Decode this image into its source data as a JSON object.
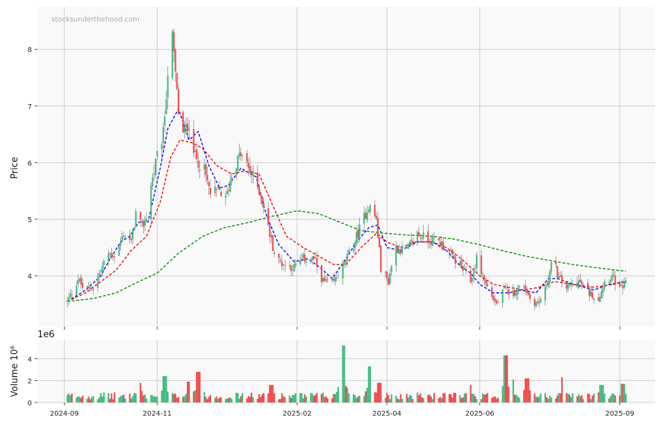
{
  "watermark": "stocksunderthehood.com",
  "chart_data": {
    "type": "candlestick",
    "start_date": "2024-09-03",
    "end_date": "2025-09-05",
    "x_ticks": [
      "2024-09",
      "2024-11",
      "2025-02",
      "2025-04",
      "2025-06",
      "2025-09"
    ],
    "x_tick_dates": [
      "2024-09-01",
      "2024-11-01",
      "2025-02-01",
      "2025-04-01",
      "2025-06-01",
      "2025-09-01"
    ],
    "price_panel": {
      "ylabel": "Price",
      "ylim": [
        3.1,
        8.75
      ],
      "yticks": [
        4,
        5,
        6,
        7,
        8
      ],
      "grid": true,
      "colors": {
        "up": "#3cba80",
        "down": "#f04848"
      },
      "anchor_points": [
        [
          "2024-09-03",
          3.55
        ],
        [
          "2024-09-06",
          3.7
        ],
        [
          "2024-09-10",
          3.95
        ],
        [
          "2024-09-14",
          3.75
        ],
        [
          "2024-09-20",
          3.8
        ],
        [
          "2024-09-25",
          4.1
        ],
        [
          "2024-09-30",
          4.4
        ],
        [
          "2024-10-05",
          4.35
        ],
        [
          "2024-10-10",
          4.75
        ],
        [
          "2024-10-15",
          4.6
        ],
        [
          "2024-10-18",
          5.1
        ],
        [
          "2024-10-22",
          4.85
        ],
        [
          "2024-10-25",
          5.05
        ],
        [
          "2024-10-28",
          5.6
        ],
        [
          "2024-11-01",
          6.1
        ],
        [
          "2024-11-05",
          6.5
        ],
        [
          "2024-11-08",
          7.6
        ],
        [
          "2024-11-11",
          8.2
        ],
        [
          "2024-11-15",
          6.9
        ],
        [
          "2024-11-18",
          6.5
        ],
        [
          "2024-11-22",
          6.7
        ],
        [
          "2024-11-26",
          6.1
        ],
        [
          "2024-12-02",
          5.85
        ],
        [
          "2024-12-06",
          5.45
        ],
        [
          "2024-12-12",
          5.5
        ],
        [
          "2024-12-16",
          5.35
        ],
        [
          "2024-12-21",
          5.9
        ],
        [
          "2024-12-26",
          6.15
        ],
        [
          "2025-01-03",
          5.75
        ],
        [
          "2025-01-08",
          5.45
        ],
        [
          "2025-01-13",
          4.85
        ],
        [
          "2025-01-18",
          4.3
        ],
        [
          "2025-01-24",
          4.2
        ],
        [
          "2025-01-30",
          4.15
        ],
        [
          "2025-02-05",
          4.3
        ],
        [
          "2025-02-12",
          4.3
        ],
        [
          "2025-02-18",
          3.9
        ],
        [
          "2025-02-24",
          3.85
        ],
        [
          "2025-03-03",
          4.15
        ],
        [
          "2025-03-10",
          4.55
        ],
        [
          "2025-03-15",
          4.9
        ],
        [
          "2025-03-20",
          5.25
        ],
        [
          "2025-03-25",
          5.0
        ],
        [
          "2025-03-28",
          4.15
        ],
        [
          "2025-04-02",
          3.9
        ],
        [
          "2025-04-06",
          4.5
        ],
        [
          "2025-04-14",
          4.45
        ],
        [
          "2025-04-21",
          4.75
        ],
        [
          "2025-04-28",
          4.65
        ],
        [
          "2025-05-06",
          4.6
        ],
        [
          "2025-05-12",
          4.4
        ],
        [
          "2025-05-20",
          4.15
        ],
        [
          "2025-05-26",
          3.9
        ],
        [
          "2025-05-30",
          4.3
        ],
        [
          "2025-06-05",
          3.85
        ],
        [
          "2025-06-12",
          3.5
        ],
        [
          "2025-06-17",
          3.75
        ],
        [
          "2025-06-23",
          3.7
        ],
        [
          "2025-06-30",
          3.85
        ],
        [
          "2025-07-04",
          3.6
        ],
        [
          "2025-07-09",
          3.5
        ],
        [
          "2025-07-14",
          3.75
        ],
        [
          "2025-07-19",
          4.3
        ],
        [
          "2025-07-23",
          3.95
        ],
        [
          "2025-07-28",
          3.8
        ],
        [
          "2025-08-05",
          3.9
        ],
        [
          "2025-08-12",
          3.7
        ],
        [
          "2025-08-18",
          3.6
        ],
        [
          "2025-08-22",
          3.9
        ],
        [
          "2025-08-27",
          4.0
        ],
        [
          "2025-09-01",
          3.75
        ],
        [
          "2025-09-05",
          3.85
        ]
      ],
      "moving_averages": [
        {
          "color": "#0000ee",
          "style": "dashed",
          "points": [
            [
              "2024-09-03",
              3.55
            ],
            [
              "2024-09-15",
              3.75
            ],
            [
              "2024-09-25",
              4.0
            ],
            [
              "2024-10-01",
              4.3
            ],
            [
              "2024-10-08",
              4.6
            ],
            [
              "2024-10-14",
              4.7
            ],
            [
              "2024-10-20",
              4.95
            ],
            [
              "2024-10-26",
              4.95
            ],
            [
              "2024-11-03",
              5.9
            ],
            [
              "2024-11-08",
              6.6
            ],
            [
              "2024-11-15",
              6.95
            ],
            [
              "2024-11-22",
              6.4
            ],
            [
              "2024-11-28",
              6.55
            ],
            [
              "2024-12-05",
              5.95
            ],
            [
              "2024-12-12",
              5.55
            ],
            [
              "2024-12-18",
              5.6
            ],
            [
              "2024-12-26",
              5.9
            ],
            [
              "2025-01-05",
              5.75
            ],
            [
              "2025-01-12",
              5.05
            ],
            [
              "2025-01-20",
              4.55
            ],
            [
              "2025-01-30",
              4.25
            ],
            [
              "2025-02-08",
              4.3
            ],
            [
              "2025-02-16",
              4.15
            ],
            [
              "2025-02-24",
              3.95
            ],
            [
              "2025-03-05",
              4.3
            ],
            [
              "2025-03-12",
              4.6
            ],
            [
              "2025-03-20",
              4.85
            ],
            [
              "2025-03-26",
              4.9
            ],
            [
              "2025-04-01",
              4.5
            ],
            [
              "2025-04-10",
              4.45
            ],
            [
              "2025-04-21",
              4.6
            ],
            [
              "2025-05-01",
              4.6
            ],
            [
              "2025-05-10",
              4.45
            ],
            [
              "2025-05-20",
              4.15
            ],
            [
              "2025-05-26",
              4.05
            ],
            [
              "2025-06-01",
              3.85
            ],
            [
              "2025-06-10",
              3.7
            ],
            [
              "2025-06-20",
              3.7
            ],
            [
              "2025-06-28",
              3.75
            ],
            [
              "2025-07-08",
              3.7
            ],
            [
              "2025-07-16",
              3.95
            ],
            [
              "2025-07-22",
              3.95
            ],
            [
              "2025-08-02",
              3.85
            ],
            [
              "2025-08-15",
              3.75
            ],
            [
              "2025-08-25",
              3.85
            ],
            [
              "2025-09-05",
              3.9
            ]
          ]
        },
        {
          "color": "#ee0000",
          "style": "dashed",
          "points": [
            [
              "2024-09-03",
              3.55
            ],
            [
              "2024-09-15",
              3.7
            ],
            [
              "2024-09-25",
              3.9
            ],
            [
              "2024-10-05",
              4.1
            ],
            [
              "2024-10-15",
              4.45
            ],
            [
              "2024-10-25",
              4.7
            ],
            [
              "2024-11-03",
              5.3
            ],
            [
              "2024-11-10",
              6.1
            ],
            [
              "2024-11-16",
              6.4
            ],
            [
              "2024-11-24",
              6.35
            ],
            [
              "2024-12-01",
              6.25
            ],
            [
              "2024-12-10",
              5.95
            ],
            [
              "2024-12-20",
              5.8
            ],
            [
              "2024-12-28",
              5.85
            ],
            [
              "2025-01-07",
              5.8
            ],
            [
              "2025-01-15",
              5.3
            ],
            [
              "2025-01-25",
              4.7
            ],
            [
              "2025-02-05",
              4.5
            ],
            [
              "2025-02-15",
              4.35
            ],
            [
              "2025-02-25",
              4.2
            ],
            [
              "2025-03-05",
              4.2
            ],
            [
              "2025-03-15",
              4.5
            ],
            [
              "2025-03-25",
              4.75
            ],
            [
              "2025-04-01",
              4.6
            ],
            [
              "2025-04-10",
              4.5
            ],
            [
              "2025-04-20",
              4.6
            ],
            [
              "2025-05-01",
              4.6
            ],
            [
              "2025-05-10",
              4.5
            ],
            [
              "2025-05-20",
              4.3
            ],
            [
              "2025-06-01",
              4.0
            ],
            [
              "2025-06-10",
              3.85
            ],
            [
              "2025-06-20",
              3.8
            ],
            [
              "2025-06-30",
              3.75
            ],
            [
              "2025-07-10",
              3.8
            ],
            [
              "2025-07-20",
              3.9
            ],
            [
              "2025-08-01",
              3.85
            ],
            [
              "2025-08-15",
              3.8
            ],
            [
              "2025-08-28",
              3.85
            ],
            [
              "2025-09-05",
              3.9
            ]
          ]
        },
        {
          "color": "#008800",
          "style": "dashed",
          "points": [
            [
              "2024-09-03",
              3.55
            ],
            [
              "2024-09-20",
              3.6
            ],
            [
              "2024-10-05",
              3.7
            ],
            [
              "2024-10-20",
              3.9
            ],
            [
              "2024-11-01",
              4.05
            ],
            [
              "2024-11-15",
              4.4
            ],
            [
              "2024-12-01",
              4.7
            ],
            [
              "2024-12-15",
              4.85
            ],
            [
              "2025-01-01",
              4.95
            ],
            [
              "2025-01-15",
              5.05
            ],
            [
              "2025-02-01",
              5.15
            ],
            [
              "2025-02-15",
              5.1
            ],
            [
              "2025-03-01",
              4.95
            ],
            [
              "2025-03-15",
              4.8
            ],
            [
              "2025-04-01",
              4.75
            ],
            [
              "2025-04-15",
              4.72
            ],
            [
              "2025-05-01",
              4.7
            ],
            [
              "2025-05-15",
              4.65
            ],
            [
              "2025-06-01",
              4.55
            ],
            [
              "2025-06-15",
              4.45
            ],
            [
              "2025-07-01",
              4.35
            ],
            [
              "2025-07-15",
              4.28
            ],
            [
              "2025-08-01",
              4.2
            ],
            [
              "2025-08-15",
              4.15
            ],
            [
              "2025-09-05",
              4.08
            ]
          ]
        }
      ]
    },
    "volume_panel": {
      "ylabel": "Volume  10⁶",
      "offset_label": "1e6",
      "ylim": [
        0,
        5.7
      ],
      "yticks": [
        0,
        2,
        4
      ],
      "grid": true,
      "typical_level": 0.8,
      "spikes": [
        [
          "2024-10-20",
          1.8
        ],
        [
          "2024-11-06",
          2.4
        ],
        [
          "2024-11-22",
          1.9
        ],
        [
          "2024-11-28",
          2.8
        ],
        [
          "2025-01-15",
          1.6
        ],
        [
          "2025-03-03",
          5.2
        ],
        [
          "2025-03-21",
          3.3
        ],
        [
          "2025-03-27",
          1.8
        ],
        [
          "2025-05-25",
          1.6
        ],
        [
          "2025-06-18",
          4.3
        ],
        [
          "2025-06-22",
          2.1
        ],
        [
          "2025-07-02",
          2.2
        ],
        [
          "2025-07-26",
          2.3
        ],
        [
          "2025-08-20",
          1.6
        ],
        [
          "2025-09-03",
          1.7
        ]
      ]
    }
  }
}
